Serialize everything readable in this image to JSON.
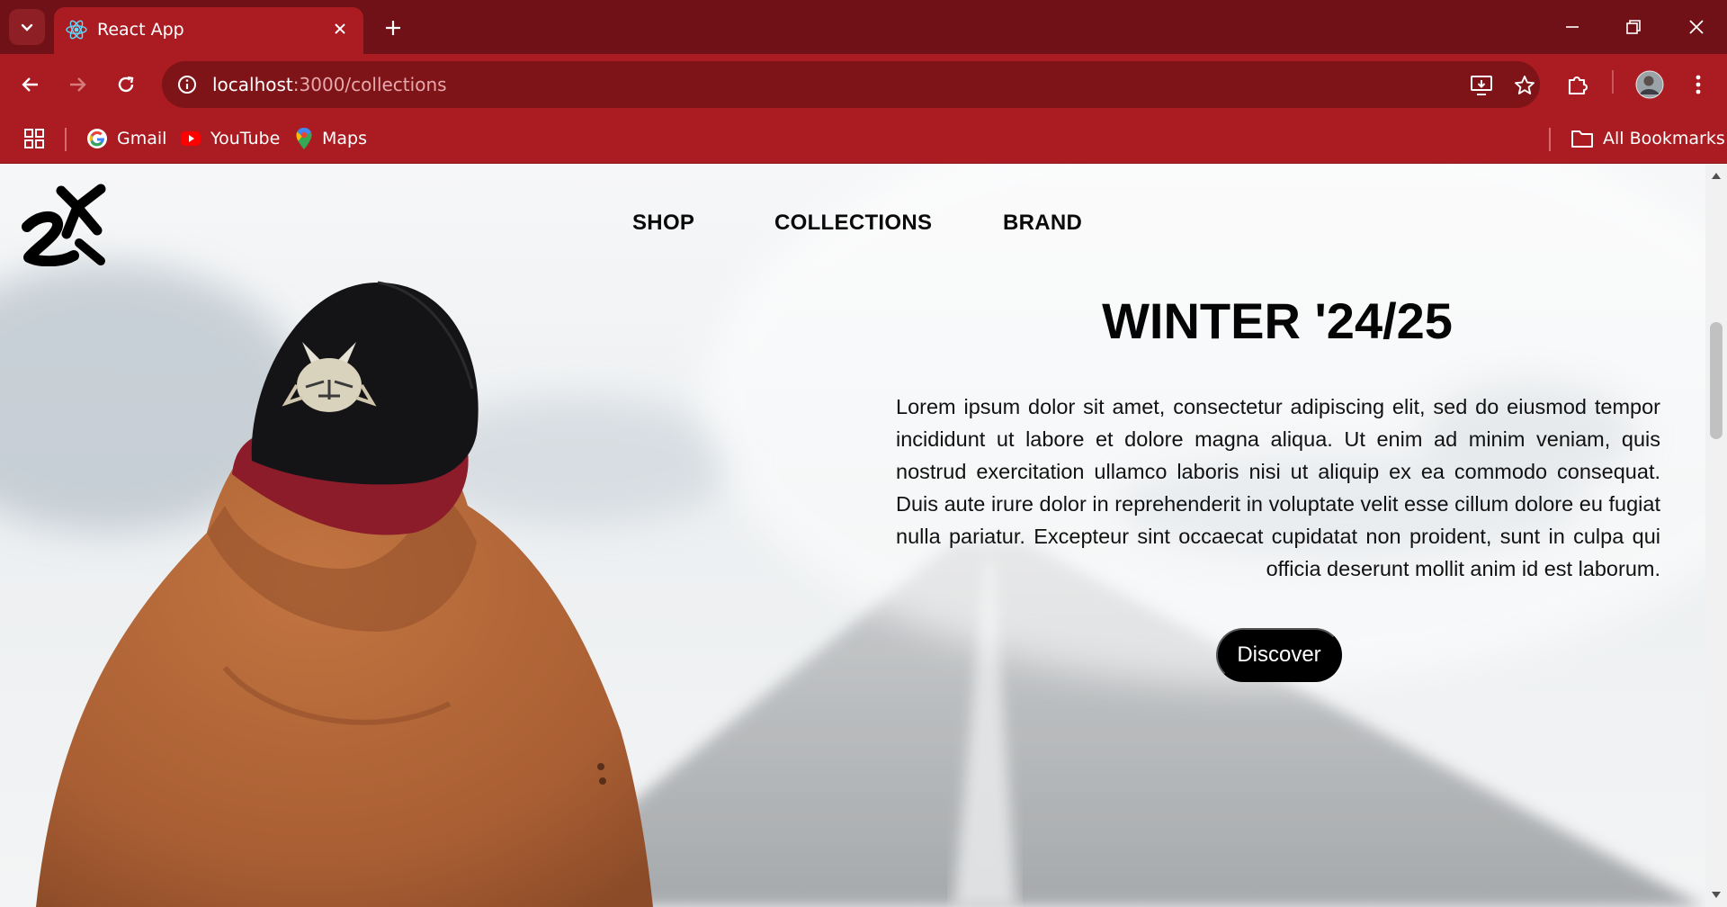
{
  "browser": {
    "tab": {
      "title": "React App"
    },
    "address": {
      "host": "localhost",
      "path": ":3000/collections"
    },
    "bookmarks": [
      {
        "label": "Gmail",
        "icon": "google-icon"
      },
      {
        "label": "YouTube",
        "icon": "youtube-icon"
      },
      {
        "label": "Maps",
        "icon": "maps-icon"
      }
    ],
    "all_bookmarks": "All Bookmarks"
  },
  "site": {
    "logo": "zx-logo",
    "nav": {
      "shop": "SHOP",
      "collections": "COLLECTIONS",
      "brand": "BRAND"
    },
    "hero": {
      "title": "WINTER '24/25",
      "text": "Lorem ipsum dolor sit amet, consectetur adipiscing elit, sed do eiusmod tempor incididunt ut labore et dolore magna aliqua. Ut enim ad minim veniam, quis nostrud exercitation ullamco laboris nisi ut aliquip ex ea commodo consequat. Duis aute irure dolor in reprehenderit in voluptate velit esse cillum dolore eu fugiat nulla pariatur. Excepteur sint occaecat cupidatat non proident, sunt in culpa qui officia deserunt mollit anim id est laborum.",
      "cta": "Discover"
    }
  },
  "colors": {
    "tabstrip": "#6f1116",
    "toolbar": "#ab1c22",
    "omnibox": "#7e1318",
    "hoodie": "#b5683a",
    "cap": "#141417",
    "cap_brim": "#8c1c2a"
  }
}
